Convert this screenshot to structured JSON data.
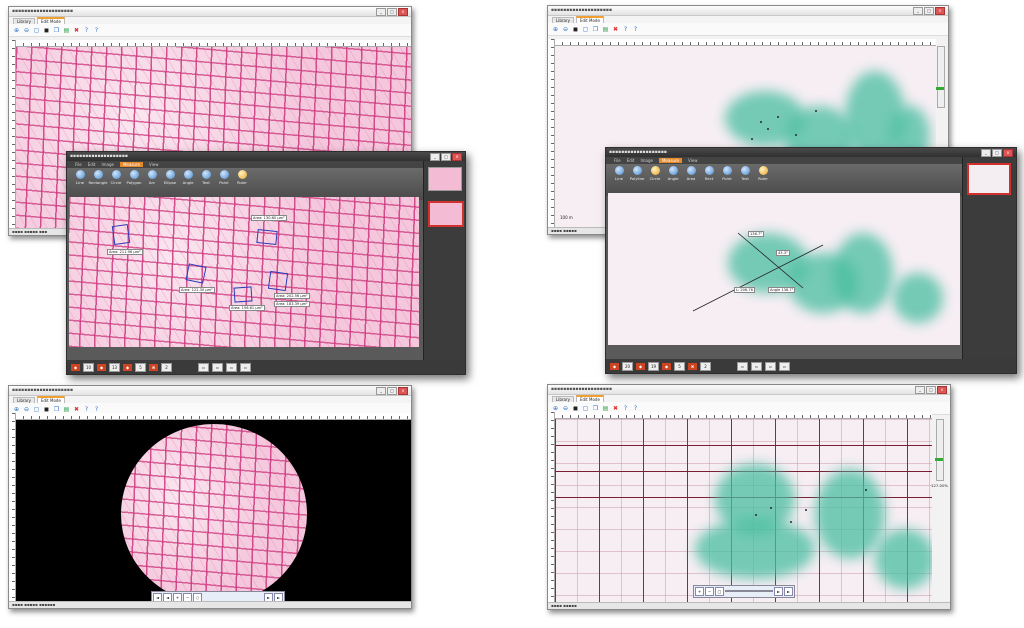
{
  "windows": {
    "top_left": {
      "tabs": [
        "Library",
        "Edit Mode"
      ]
    },
    "top_right": {
      "tabs": [
        "Library",
        "Edit Mode"
      ],
      "scale_label": "100 m"
    },
    "bottom_left": {
      "tabs": [
        "Library",
        "Edit Mode"
      ],
      "zoom_controls": [
        "◄",
        "◄",
        "+",
        "−",
        "○",
        "►",
        "►"
      ]
    },
    "bottom_right": {
      "tabs": [
        "Library",
        "Edit Mode"
      ],
      "zoom_value": "127.00%"
    },
    "overlay_left": {
      "menu_tabs": [
        "File",
        "Edit",
        "Image",
        "Measure",
        "View"
      ],
      "active_tab": "Measure",
      "tools": [
        "Line",
        "Rectangle",
        "Circle",
        "Polygon",
        "Arc",
        "Ellipse",
        "Angle",
        "Text",
        "Point",
        "Ruler"
      ],
      "status_values": [
        "10",
        "13",
        "5",
        "2"
      ],
      "annotations": [
        "Area: 211.96 μm²",
        "Area: 122.30 μm²",
        "Area: 156.61 μm²",
        "Area: 202.56 μm²",
        "Area: 130.60 μm²",
        "Area: 183.39 μm²"
      ]
    },
    "overlay_right": {
      "menu_tabs": [
        "File",
        "Edit",
        "Image",
        "Measure",
        "View"
      ],
      "active_tab": "Measure",
      "tools": [
        "Line",
        "Polyline",
        "Circle",
        "Angle",
        "Area",
        "Rect",
        "Point",
        "Text",
        "Ruler"
      ],
      "status_values": [
        "20",
        "19",
        "5",
        "2"
      ],
      "annotations": [
        "136.7°",
        "43.3°",
        "L: 206.76",
        "Angle 136.7°"
      ]
    }
  },
  "colors": {
    "accent": "#e58a2a",
    "tissue": "#f4c7dc",
    "stain": "#48bea0",
    "outline": "#2a3cb8",
    "selection": "#d0312d"
  }
}
